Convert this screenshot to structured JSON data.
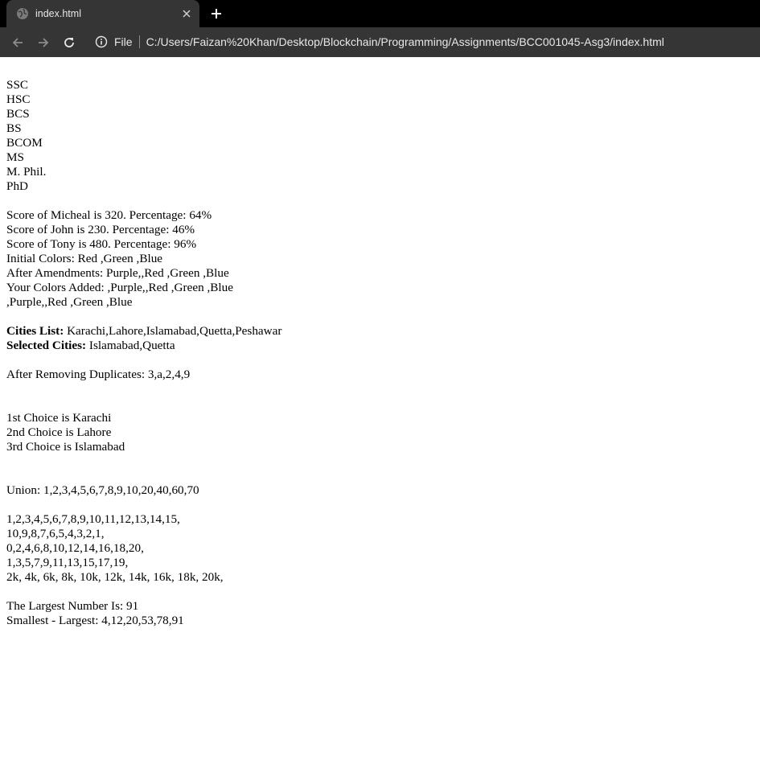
{
  "browser": {
    "tab_title": "index.html",
    "scheme_label": "File",
    "url": "C:/Users/Faizan%20Khan/Desktop/Blockchain/Programming/Assignments/BCC001045-Asg3/index.html",
    "icons": {
      "favicon": "globe-icon",
      "close": "close-icon",
      "new_tab": "plus-icon",
      "back": "arrow-left-icon",
      "forward": "arrow-right-icon",
      "reload": "reload-icon",
      "info": "info-icon"
    },
    "colors": {
      "tabstrip": "#000000",
      "toolbar": "#353535",
      "text": "#e8e8e8"
    }
  },
  "page": {
    "degrees": [
      "SSC",
      "HSC",
      "BCS",
      "BS",
      "BCOM",
      "MS",
      "M. Phil.",
      "PhD"
    ],
    "scores": [
      "Score of Micheal is 320. Percentage: 64%",
      "Score of John is 230. Percentage: 46%",
      "Score of Tony is 480. Percentage: 96%"
    ],
    "colors_lines": [
      "Initial Colors: Red ,Green ,Blue",
      "After Amendments: Purple,,Red ,Green ,Blue",
      "Your Colors Added: ,Purple,,Red ,Green ,Blue",
      ",Purple,,Red ,Green ,Blue"
    ],
    "cities": {
      "list_label": "Cities List:",
      "list_value": " Karachi,Lahore,Islamabad,Quetta,Peshawar",
      "selected_label": "Selected Cities:",
      "selected_value": " Islamabad,Quetta"
    },
    "duplicates": "After Removing Duplicates: 3,a,2,4,9",
    "choices": [
      "1st Choice is Karachi",
      "2nd Choice is Lahore",
      "3rd Choice is Islamabad"
    ],
    "union": "Union: 1,2,3,4,5,6,7,8,9,10,20,40,60,70",
    "sequences": [
      "1,2,3,4,5,6,7,8,9,10,11,12,13,14,15,",
      "10,9,8,7,6,5,4,3,2,1,",
      "0,2,4,6,8,10,12,14,16,18,20,",
      "1,3,5,7,9,11,13,15,17,19,",
      "2k, 4k, 6k, 8k, 10k, 12k, 14k, 16k, 18k, 20k,"
    ],
    "largest": "The Largest Number Is: 91",
    "sorted": "Smallest - Largest: 4,12,20,53,78,91"
  }
}
